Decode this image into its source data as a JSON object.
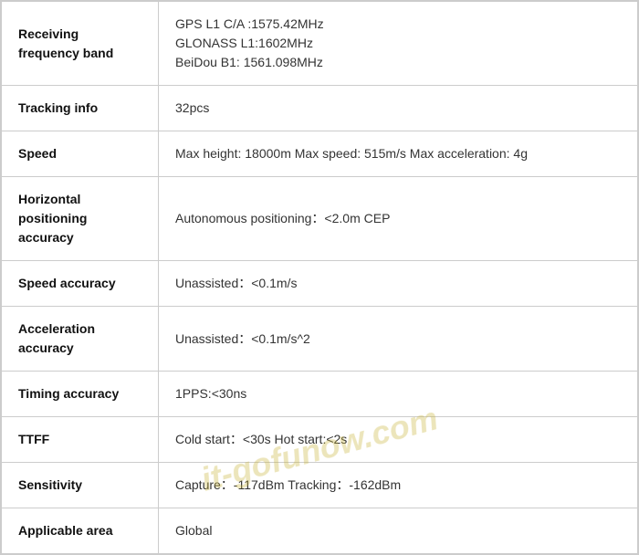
{
  "table": {
    "rows": [
      {
        "label": "Receiving frequency band",
        "value": "GPS L1 C/A :1575.42MHz\nGLONASS L1:1602MHz\nBeiDou B1: 1561.098MHz",
        "multiline": true
      },
      {
        "label": "Tracking info",
        "value": "32pcs",
        "multiline": false
      },
      {
        "label": "Speed",
        "value": "Max height:  18000m  Max speed:  515m/s  Max acceleration:  4g",
        "multiline": false
      },
      {
        "label": "Horizontal positioning accuracy",
        "value": "Autonomous positioning：<2.0m CEP",
        "multiline": false
      },
      {
        "label": "Speed accuracy",
        "value": "Unassisted：<0.1m/s",
        "multiline": false
      },
      {
        "label": "Acceleration accuracy",
        "value": "Unassisted：<0.1m/s^2",
        "multiline": false
      },
      {
        "label": "Timing accuracy",
        "value": "1PPS:<30ns",
        "multiline": false
      },
      {
        "label": "TTFF",
        "value": "Cold start：<30s  Hot start:<2s",
        "multiline": false
      },
      {
        "label": "Sensitivity",
        "value": "Capture：-117dBm  Tracking：-162dBm",
        "multiline": false
      },
      {
        "label": "Applicable area",
        "value": "Global",
        "multiline": false
      }
    ]
  },
  "watermark": {
    "text": "it-gofunow.com"
  }
}
